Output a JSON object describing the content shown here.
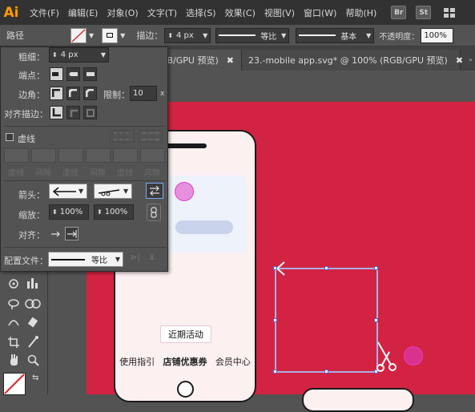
{
  "app": {
    "logo": "Ai"
  },
  "menu": [
    "文件(F)",
    "编辑(E)",
    "对象(O)",
    "文字(T)",
    "选择(S)",
    "效果(C)",
    "视图(V)",
    "窗口(W)",
    "帮助(H)"
  ],
  "app_buttons": [
    "Br",
    "St"
  ],
  "control": {
    "panel_name": "路径",
    "stroke_label": "描边：",
    "stroke_value": "4 px",
    "profile_label": "等比",
    "brush_label": "基本",
    "opacity_label": "不透明度：",
    "opacity_value": "100%"
  },
  "tabs": [
    {
      "label": "GB/GPU 预览)",
      "close": "✖",
      "active": true
    },
    {
      "label": "23.-mobile app.svg* @ 100% (RGB/GPU 预览)",
      "close": "✖",
      "active": false
    }
  ],
  "stroke_panel": {
    "weight_label": "粗细：",
    "weight_value": "4 px",
    "cap_label": "端点：",
    "corner_label": "边角：",
    "limit_label": "限制：",
    "limit_value": "10",
    "limit_unit": "x",
    "align_label": "对齐描边：",
    "dashed_label": "虚线",
    "dash_labels": [
      "虚线",
      "间隙",
      "虚线",
      "间隙",
      "虚线",
      "间隙"
    ],
    "arrow_label": "箭头：",
    "scale_label": "缩放：",
    "scale_start": "100%",
    "scale_end": "100%",
    "align2_label": "对齐：",
    "profile_label": "配置文件：",
    "profile_value": "等比"
  },
  "artboard": {
    "promo_button": "近期活动",
    "nav": [
      "使用指引",
      "店铺优惠券",
      "会员中心"
    ]
  },
  "colors": {
    "artboard": "#d32342",
    "menu_bg": "#323232",
    "panel_bg": "#535353",
    "logo": "#ff9a00",
    "selection": "#5a5fcf",
    "cursor_ring": "#e040c8"
  },
  "icons": [
    "gear-icon",
    "scissors-icon",
    "swap-arrows-icon",
    "link-icon",
    "hand-icon",
    "zoom-icon",
    "pen-icon",
    "bar-graph-icon"
  ]
}
